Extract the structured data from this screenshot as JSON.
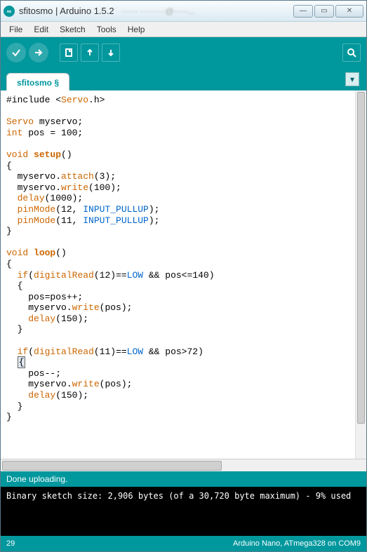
{
  "window": {
    "app_icon_text": "∞",
    "title": "sfitosmo | Arduino 1.5.2",
    "blurred_extra": "······ ·········@·····..."
  },
  "win_controls": {
    "min": "—",
    "max": "▭",
    "close": "✕"
  },
  "menu": {
    "file": "File",
    "edit": "Edit",
    "sketch": "Sketch",
    "tools": "Tools",
    "help": "Help"
  },
  "tabs": {
    "active": "sfitosmo §"
  },
  "code": {
    "l01a": "#include <",
    "l01b": "Servo",
    "l01c": ".h>",
    "blank": " ",
    "l03a": "Servo",
    "l03b": " myservo;",
    "l04a": "int",
    "l04b": " pos = 100;",
    "l06a": "void",
    "l06b": " ",
    "l06c": "setup",
    "l06d": "()",
    "l07": "{",
    "l08a": "  myservo.",
    "l08b": "attach",
    "l08c": "(3);",
    "l09a": "  myservo.",
    "l09b": "write",
    "l09c": "(100);",
    "l10a": "  ",
    "l10b": "delay",
    "l10c": "(1000);",
    "l11a": "  ",
    "l11b": "pinMode",
    "l11c": "(12, ",
    "l11d": "INPUT_PULLUP",
    "l11e": ");",
    "l12a": "  ",
    "l12b": "pinMode",
    "l12c": "(11, ",
    "l12d": "INPUT_PULLUP",
    "l12e": ");",
    "l13": "}",
    "l15a": "void",
    "l15b": " ",
    "l15c": "loop",
    "l15d": "()",
    "l16": "{",
    "l17a": "  ",
    "l17b": "if",
    "l17c": "(",
    "l17d": "digitalRead",
    "l17e": "(12)==",
    "l17f": "LOW",
    "l17g": " && pos<=140)",
    "l18": "  {",
    "l19": "    pos=pos++;",
    "l20a": "    myservo.",
    "l20b": "write",
    "l20c": "(pos);",
    "l21a": "    ",
    "l21b": "delay",
    "l21c": "(150);",
    "l22": "  }",
    "l24a": "  ",
    "l24b": "if",
    "l24c": "(",
    "l24d": "digitalRead",
    "l24e": "(11)==",
    "l24f": "LOW",
    "l24g": " && pos>72)",
    "l25a": "  ",
    "l25b": "{",
    "l26": "    pos--;",
    "l27a": "    myservo.",
    "l27b": "write",
    "l27c": "(pos);",
    "l28a": "    ",
    "l28b": "delay",
    "l28c": "(150);",
    "l29": "  }",
    "l30": "}"
  },
  "status": {
    "upload": "Done uploading."
  },
  "console": {
    "line1": "Binary sketch size: 2,906 bytes (of a 30,720 byte maximum) - 9% used"
  },
  "statusbar": {
    "line": "29",
    "board": "Arduino Nano, ATmega328 on COM9"
  },
  "dropdown_glyph": "▾"
}
